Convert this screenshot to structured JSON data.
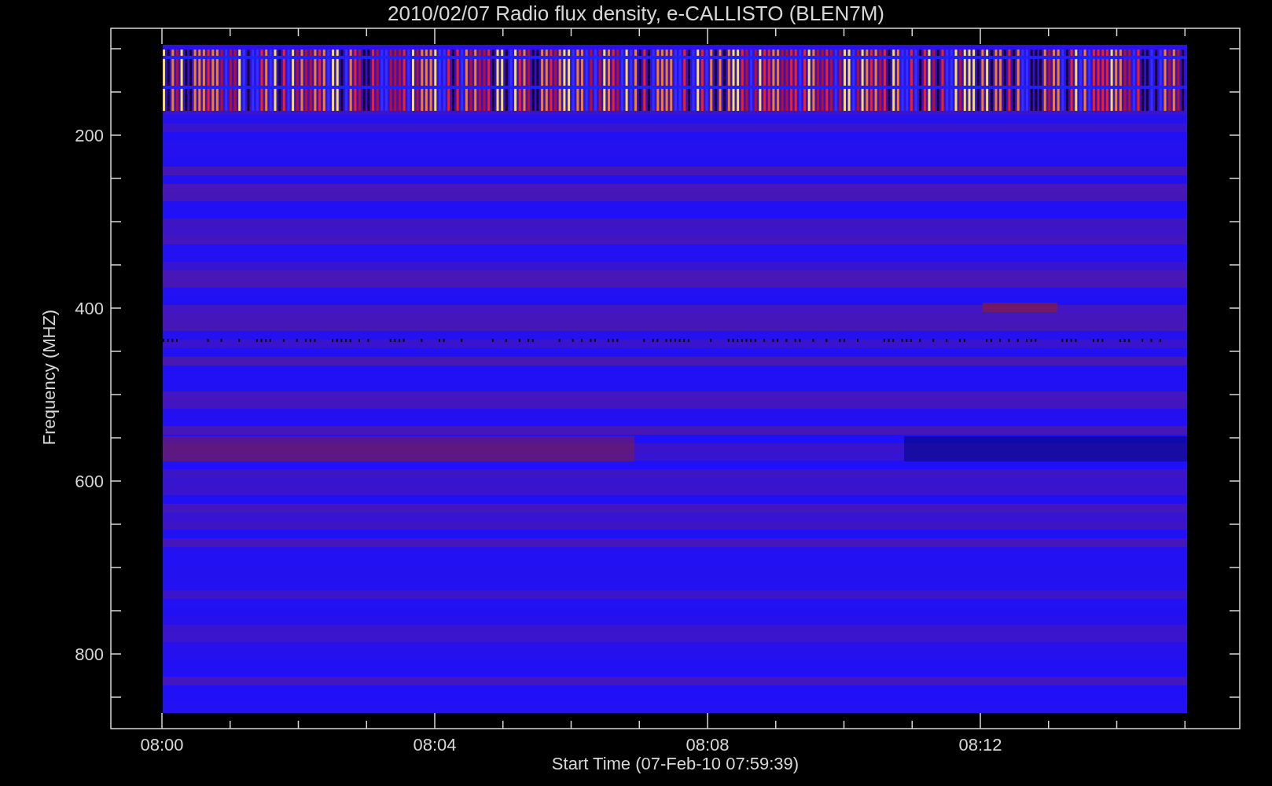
{
  "plot": {
    "title": "2010/02/07  Radio flux density, e-CALLISTO (BLEN7M)",
    "x_axis": {
      "label": "Start Time (07-Feb-10 07:59:39)",
      "ticks": [
        "08:00",
        "08:04",
        "08:08",
        "08:12"
      ]
    },
    "y_axis": {
      "label": "Frequency (MHZ)",
      "ticks": [
        "200",
        "400",
        "600",
        "800"
      ]
    }
  }
}
